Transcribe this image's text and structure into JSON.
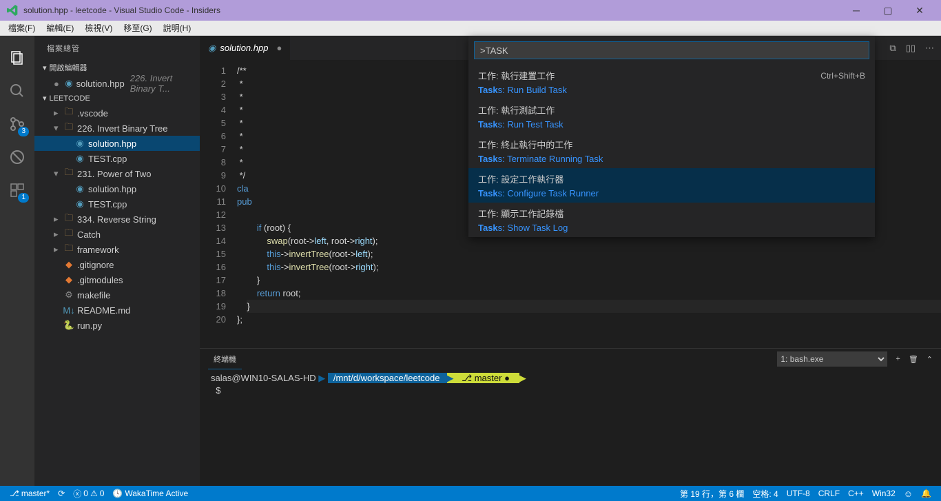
{
  "title": "solution.hpp - leetcode - Visual Studio Code - Insiders",
  "menubar": [
    "檔案(F)",
    "編輯(E)",
    "檢視(V)",
    "移至(G)",
    "說明(H)"
  ],
  "sidebar": {
    "title": "檔案總管",
    "sections": {
      "open_editors": "開啟編輯器",
      "workspace": "LEETCODE"
    },
    "open_editors": [
      {
        "name": "solution.hpp",
        "hint": "226. Invert Binary T...",
        "icon": "cpp"
      }
    ],
    "tree": [
      {
        "name": ".vscode",
        "type": "folder",
        "depth": 1,
        "collapsed": true
      },
      {
        "name": "226. Invert Binary Tree",
        "type": "folder",
        "depth": 1,
        "collapsed": false
      },
      {
        "name": "solution.hpp",
        "type": "cpp",
        "depth": 2,
        "selected": true
      },
      {
        "name": "TEST.cpp",
        "type": "cpp",
        "depth": 2
      },
      {
        "name": "231. Power of Two",
        "type": "folder",
        "depth": 1,
        "collapsed": false
      },
      {
        "name": "solution.hpp",
        "type": "cpp",
        "depth": 2
      },
      {
        "name": "TEST.cpp",
        "type": "cpp",
        "depth": 2
      },
      {
        "name": "334. Reverse String",
        "type": "folder",
        "depth": 1,
        "collapsed": true
      },
      {
        "name": "Catch",
        "type": "folder",
        "depth": 1,
        "collapsed": true
      },
      {
        "name": "framework",
        "type": "folder",
        "depth": 1,
        "collapsed": true
      },
      {
        "name": ".gitignore",
        "type": "hash",
        "depth": 1
      },
      {
        "name": ".gitmodules",
        "type": "hash",
        "depth": 1
      },
      {
        "name": "makefile",
        "type": "gear",
        "depth": 1
      },
      {
        "name": "README.md",
        "type": "md",
        "depth": 1
      },
      {
        "name": "run.py",
        "type": "py",
        "depth": 1
      }
    ]
  },
  "tabs": [
    {
      "name": "solution.hpp",
      "icon": "cpp"
    }
  ],
  "palette": {
    "query": ">TASK",
    "items": [
      {
        "title": "工作: 執行建置工作",
        "sub": "Tasks: Run Build Task",
        "kbd": "Ctrl+Shift+B"
      },
      {
        "title": "工作: 執行測試工作",
        "sub": "Tasks: Run Test Task"
      },
      {
        "title": "工作: 終止執行中的工作",
        "sub": "Tasks: Terminate Running Task"
      },
      {
        "title": "工作: 設定工作執行器",
        "sub": "Tasks: Configure Task Runner",
        "selected": true
      },
      {
        "title": "工作: 顯示工作記錄檔",
        "sub": "Tasks: Show Task Log"
      }
    ]
  },
  "code": {
    "lines": [
      "/**",
      " *",
      " *",
      " *",
      " *",
      " *",
      " *",
      " *",
      " */",
      "class",
      "pub",
      "",
      "        if (root) {",
      "            swap(root->left, root->right);",
      "            this->invertTree(root->left);",
      "            this->invertTree(root->right);",
      "        }",
      "        return root;",
      "    }",
      "};"
    ]
  },
  "panel": {
    "tab": "終端機",
    "select": "1: bash.exe",
    "prompt_user": "salas@WIN10-SALAS-HD",
    "prompt_path": "/mnt/d/workspace/leetcode",
    "prompt_branch": "master",
    "prompt2": "$"
  },
  "statusbar": {
    "branch": "master*",
    "errors": "0",
    "warnings": "0",
    "wakatime": "WakaTime Active",
    "position": "第 19 行，第 6 欄",
    "spaces": "空格: 4",
    "encoding": "UTF-8",
    "eol": "CRLF",
    "lang": "C++",
    "platform": "Win32"
  },
  "activity_badges": {
    "scm": "3",
    "last": "1"
  }
}
